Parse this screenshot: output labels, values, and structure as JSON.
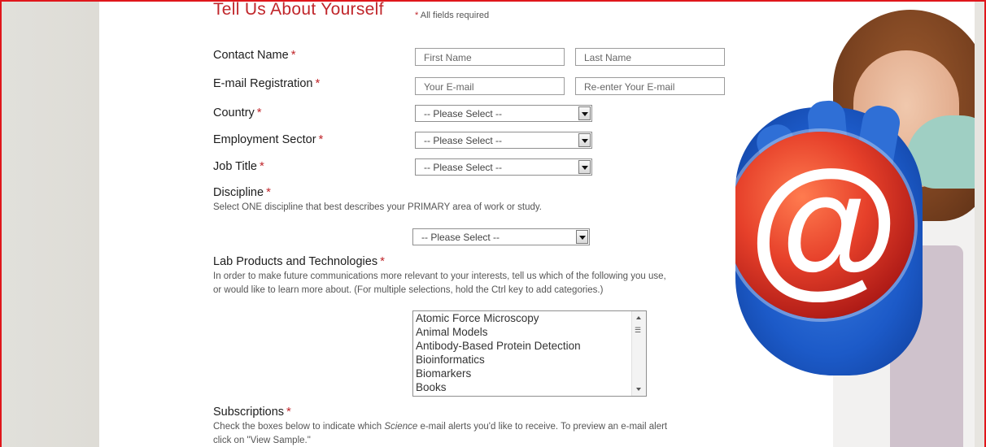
{
  "form": {
    "section_title": "Tell Us About Yourself",
    "required_note": "All fields required",
    "asterisk": "*",
    "contact_name": {
      "label": "Contact Name",
      "first_placeholder": "First Name",
      "last_placeholder": "Last Name"
    },
    "email": {
      "label": "E-mail Registration",
      "email_placeholder": "Your E-mail",
      "confirm_placeholder": "Re-enter Your E-mail"
    },
    "country": {
      "label": "Country",
      "selected": "-- Please Select --"
    },
    "employment_sector": {
      "label": "Employment Sector",
      "selected": "-- Please Select --"
    },
    "job_title": {
      "label": "Job Title",
      "selected": "-- Please Select --"
    },
    "discipline": {
      "label": "Discipline",
      "help": "Select ONE discipline that best describes your PRIMARY area of work or study.",
      "selected": "-- Please Select --"
    },
    "lab_products": {
      "label": "Lab Products and Technologies",
      "help_line1": "In order to make future communications more relevant to your interests, tell us which of the following you use,",
      "help_line2": "or would like to learn more about. (For multiple selections, hold the Ctrl key to add categories.)",
      "options": [
        "Atomic Force Microscopy",
        "Animal Models",
        "Antibody-Based Protein Detection",
        "Bioinformatics",
        "Biomarkers",
        "Books"
      ]
    },
    "subscriptions": {
      "label": "Subscriptions",
      "help_pre": "Check the boxes below to indicate which ",
      "help_em": "Science",
      "help_post": " e-mail alerts you'd like to receive. To preview an e-mail alert",
      "help_line2": "click on \"View Sample.\""
    }
  },
  "hero": {
    "symbol": "@",
    "icon": "petri-dish-at-icon"
  },
  "colors": {
    "accent": "#c0262b",
    "border": "#e0161b",
    "glove": "#2f6fd6"
  }
}
